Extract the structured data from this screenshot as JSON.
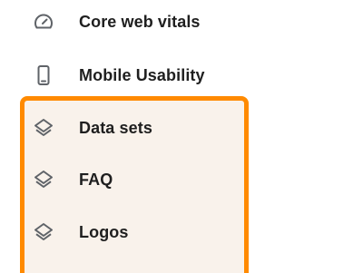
{
  "nav": {
    "items": [
      {
        "label": "Core web vitals",
        "icon": "speedometer-icon"
      },
      {
        "label": "Mobile Usability",
        "icon": "smartphone-icon"
      },
      {
        "label": "Data sets",
        "icon": "layers-icon"
      },
      {
        "label": "FAQ",
        "icon": "layers-icon"
      },
      {
        "label": "Logos",
        "icon": "layers-icon"
      }
    ]
  },
  "colors": {
    "highlight_border": "#ff8a00",
    "highlight_background": "#f9f2eb",
    "icon": "#5f6368",
    "text": "#1f1f1f"
  }
}
